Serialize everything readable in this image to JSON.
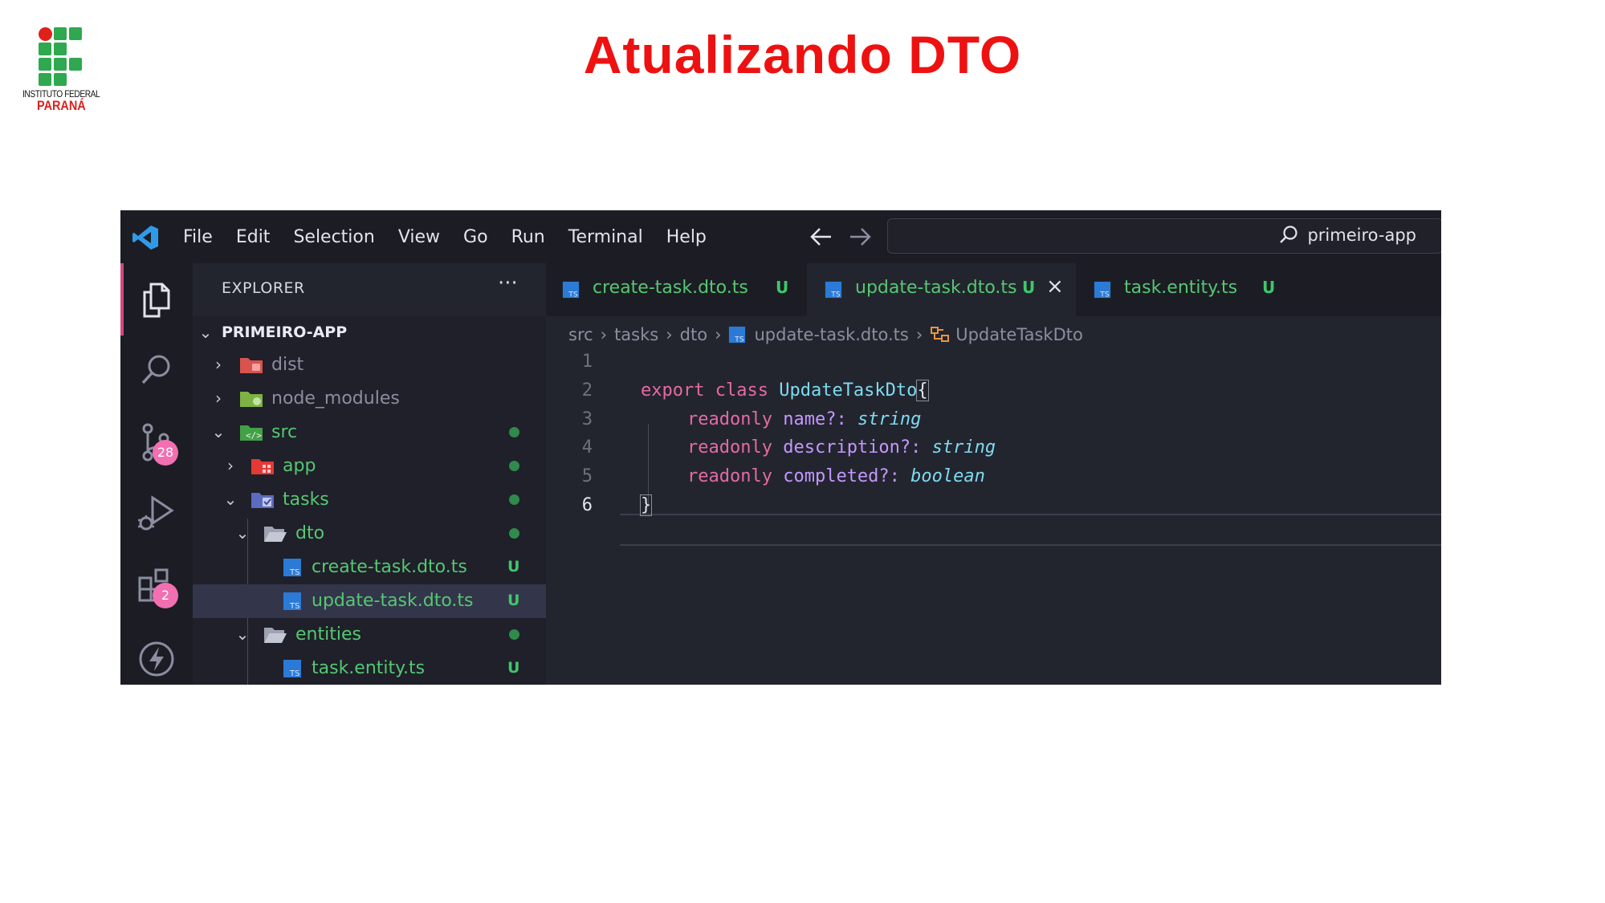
{
  "slide": {
    "title": "Atualizando DTO",
    "logo": {
      "line1": "INSTITUTO FEDERAL",
      "line2": "PARANÁ"
    }
  },
  "window": {
    "menu": [
      "File",
      "Edit",
      "Selection",
      "View",
      "Go",
      "Run",
      "Terminal",
      "Help"
    ],
    "search_text": "primeiro-app"
  },
  "activity_bar": {
    "items": [
      {
        "name": "explorer-icon"
      },
      {
        "name": "search-icon"
      },
      {
        "name": "source-control-icon",
        "badge": "28"
      },
      {
        "name": "run-debug-icon"
      },
      {
        "name": "extensions-icon",
        "badge": "2"
      },
      {
        "name": "lightning-icon"
      }
    ]
  },
  "sidebar": {
    "title": "EXPLORER",
    "more": "···",
    "root": "PRIMEIRO-APP",
    "tree": [
      {
        "label": "dist",
        "status": "",
        "color": "#8b8ea0"
      },
      {
        "label": "node_modules",
        "status": "",
        "color": "#8b8ea0"
      },
      {
        "label": "src",
        "status": "dot",
        "color": "#56c772"
      },
      {
        "label": "app",
        "status": "dot",
        "color": "#56c772"
      },
      {
        "label": "tasks",
        "status": "dot",
        "color": "#56c772"
      },
      {
        "label": "dto",
        "status": "dot",
        "color": "#56c772"
      },
      {
        "label": "create-task.dto.ts",
        "status": "U",
        "color": "#56c772"
      },
      {
        "label": "update-task.dto.ts",
        "status": "U",
        "color": "#56c772",
        "selected": true
      },
      {
        "label": "entities",
        "status": "dot",
        "color": "#56c772"
      },
      {
        "label": "task.entity.ts",
        "status": "U",
        "color": "#56c772"
      }
    ]
  },
  "tabs": [
    {
      "label": "create-task.dto.ts",
      "status": "U",
      "active": false
    },
    {
      "label": "update-task.dto.ts",
      "status": "U",
      "active": true,
      "close": "×"
    },
    {
      "label": "task.entity.ts",
      "status": "U",
      "active": false
    }
  ],
  "breadcrumb": {
    "parts": [
      "src",
      "tasks",
      "dto"
    ],
    "file": "update-task.dto.ts",
    "symbol": "UpdateTaskDto"
  },
  "code": {
    "line_numbers": [
      "1",
      "2",
      "3",
      "4",
      "5",
      "6"
    ],
    "line2": {
      "kw1": "export",
      "kw2": "class",
      "name": "UpdateTaskDto",
      "open": "{"
    },
    "line3": {
      "kw": "readonly",
      "prop": "name?:",
      "type": "string"
    },
    "line4": {
      "kw": "readonly",
      "prop": "description?:",
      "type": "string"
    },
    "line5": {
      "kw": "readonly",
      "prop": "completed?:",
      "type": "boolean"
    },
    "line6": {
      "close": "}"
    }
  },
  "colors": {
    "title_red": "#ee1111",
    "git_green": "#56c772",
    "badge_pink": "#f26fb1",
    "keyword": "#e46aa4",
    "class_name": "#7edbf0",
    "property": "#c497ff"
  }
}
